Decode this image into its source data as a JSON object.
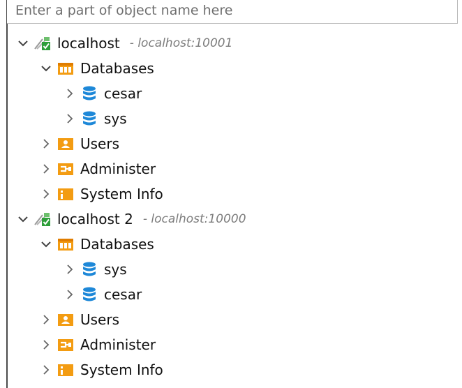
{
  "search": {
    "placeholder": "Enter a part of object name here"
  },
  "tree": {
    "connections": [
      {
        "name": "localhost",
        "subtitle": "- localhost:10001",
        "databases_label": "Databases",
        "databases": [
          "cesar",
          "sys"
        ],
        "users_label": "Users",
        "administer_label": "Administer",
        "system_info_label": "System Info"
      },
      {
        "name": "localhost 2",
        "subtitle": "- localhost:10000",
        "databases_label": "Databases",
        "databases": [
          "sys",
          "cesar"
        ],
        "users_label": "Users",
        "administer_label": "Administer",
        "system_info_label": "System Info"
      }
    ]
  },
  "colors": {
    "folder_orange": "#f39c12",
    "database_blue": "#1e88d8",
    "connection_green": "#2e9e3a",
    "italic_gray": "#7c7c7c"
  },
  "icons": {
    "expanded": "chevron-down-icon",
    "collapsed": "chevron-right-icon",
    "connection": "connection-icon",
    "databases": "databases-folder-icon",
    "database": "database-icon",
    "users": "users-folder-icon",
    "administer": "administer-folder-icon",
    "system_info": "system-info-folder-icon"
  }
}
